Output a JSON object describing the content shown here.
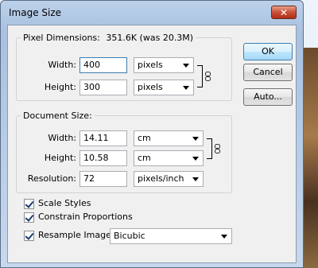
{
  "window": {
    "title": "Image Size",
    "close_glyph": "✕"
  },
  "pixel_dimensions": {
    "legend": "Pixel Dimensions:",
    "summary": "351.6K (was 20.3M)",
    "width_label": "Width:",
    "width_value": "400",
    "width_unit": "pixels",
    "height_label": "Height:",
    "height_value": "300",
    "height_unit": "pixels"
  },
  "document_size": {
    "legend": "Document Size:",
    "width_label": "Width:",
    "width_value": "14.11",
    "width_unit": "cm",
    "height_label": "Height:",
    "height_value": "10.58",
    "height_unit": "cm",
    "resolution_label": "Resolution:",
    "resolution_value": "72",
    "resolution_unit": "pixels/inch"
  },
  "options": {
    "scale_styles": {
      "label": "Scale Styles",
      "checked": true
    },
    "constrain_proportions": {
      "label": "Constrain Proportions",
      "checked": true
    },
    "resample_image": {
      "label": "Resample Image:",
      "checked": true,
      "method": "Bicubic"
    }
  },
  "buttons": {
    "ok": "OK",
    "cancel": "Cancel",
    "auto": "Auto..."
  },
  "icons": {
    "link": "chain-link-icon",
    "close": "close-icon",
    "dropdown": "chevron-down-icon",
    "check": "checkmark-icon"
  }
}
